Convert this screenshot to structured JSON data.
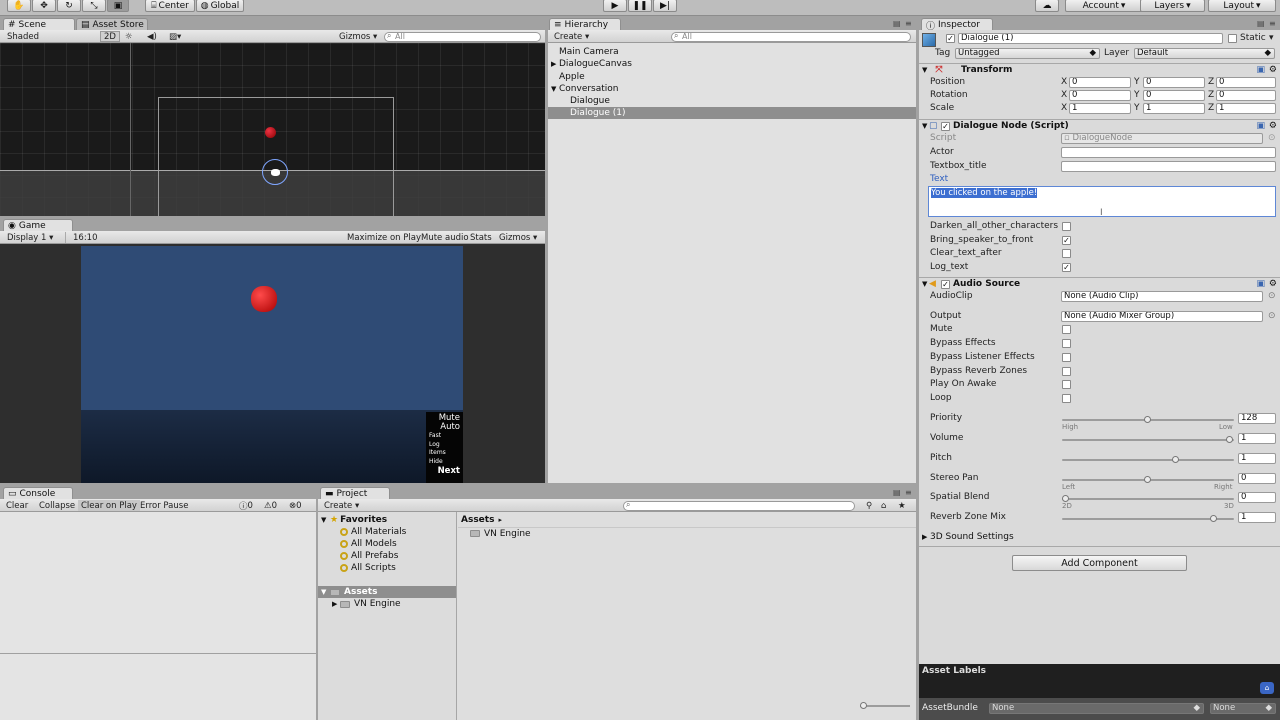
{
  "toolbar": {
    "pivot_label": "Center",
    "space_label": "Global",
    "account_label": "Account",
    "layers_label": "Layers",
    "layout_label": "Layout"
  },
  "scene": {
    "tab_label": "Scene",
    "asset_store_tab": "Asset Store",
    "shading_label": "Shaded",
    "mode_2d": "2D",
    "gizmos_label": "Gizmos",
    "search_placeholder": "All"
  },
  "game": {
    "tab_label": "Game",
    "display_label": "Display 1",
    "aspect_label": "16:10",
    "maximize_label": "Maximize on Play",
    "mute_label": "Mute audio",
    "stats_label": "Stats",
    "gizmos_label": "Gizmos",
    "menu": [
      "Mute",
      "Auto",
      "Fast",
      "Log",
      "Items",
      "Hide",
      "Next"
    ]
  },
  "hierarchy": {
    "tab_label": "Hierarchy",
    "create_label": "Create",
    "search_placeholder": "All",
    "items": [
      "Main Camera",
      "DialogueCanvas",
      "Apple",
      "Conversation",
      "Dialogue",
      "Dialogue (1)"
    ]
  },
  "console": {
    "tab_label": "Console",
    "buttons": [
      "Clear",
      "Collapse",
      "Clear on Play",
      "Error Pause"
    ],
    "counts": [
      "0",
      "0",
      "0"
    ]
  },
  "project": {
    "tab_label": "Project",
    "create_label": "Create",
    "favorites_label": "Favorites",
    "favorites": [
      "All Materials",
      "All Models",
      "All Prefabs",
      "All Scripts"
    ],
    "assets_label": "Assets",
    "tree_child": "VN Engine",
    "breadcrumb": "Assets",
    "grid_items": [
      "VN Engine"
    ]
  },
  "inspector": {
    "tab_label": "Inspector",
    "object_name": "Dialogue (1)",
    "static_label": "Static",
    "tag_label": "Tag",
    "tag_value": "Untagged",
    "layer_label": "Layer",
    "layer_value": "Default",
    "transform": {
      "title": "Transform",
      "rows": [
        {
          "label": "Position",
          "x": "0",
          "y": "0",
          "z": "0"
        },
        {
          "label": "Rotation",
          "x": "0",
          "y": "0",
          "z": "0"
        },
        {
          "label": "Scale",
          "x": "1",
          "y": "1",
          "z": "1"
        }
      ]
    },
    "dialogue_node": {
      "title": "Dialogue Node (Script)",
      "script_label": "Script",
      "script_value": "DialogueNode",
      "actor_label": "Actor",
      "textbox_label": "Textbox_title",
      "text_label": "Text",
      "text_value": "You clicked on the apple!",
      "toggles": [
        {
          "label": "Darken_all_other_characters",
          "checked": false
        },
        {
          "label": "Bring_speaker_to_front",
          "checked": true
        },
        {
          "label": "Clear_text_after",
          "checked": false
        },
        {
          "label": "Log_text",
          "checked": true
        }
      ]
    },
    "audio_source": {
      "title": "Audio Source",
      "clip_label": "AudioClip",
      "clip_value": "None (Audio Clip)",
      "output_label": "Output",
      "output_value": "None (Audio Mixer Group)",
      "toggles": [
        "Mute",
        "Bypass Effects",
        "Bypass Listener Effects",
        "Bypass Reverb Zones",
        "Play On Awake",
        "Loop"
      ],
      "priority_label": "Priority",
      "priority_value": "128",
      "priority_fraction": 0.5,
      "priority_low": "High",
      "priority_high": "Low",
      "volume_label": "Volume",
      "volume_value": "1",
      "volume_fraction": 1.0,
      "pitch_label": "Pitch",
      "pitch_value": "1",
      "pitch_fraction": 0.67,
      "pan_label": "Stereo Pan",
      "pan_value": "0",
      "pan_fraction": 0.5,
      "pan_left": "Left",
      "pan_right": "Right",
      "blend_label": "Spatial Blend",
      "blend_value": "0",
      "blend_fraction": 0.0,
      "blend_min": "2D",
      "blend_max": "3D",
      "reverb_label": "Reverb Zone Mix",
      "reverb_value": "1",
      "reverb_fraction": 0.9
    },
    "sound_settings_label": "3D Sound Settings",
    "add_component_label": "Add Component",
    "asset_labels_title": "Asset Labels",
    "assetbundle_label": "AssetBundle",
    "assetbundle_value": "None",
    "assetbundle_variant": "None"
  }
}
